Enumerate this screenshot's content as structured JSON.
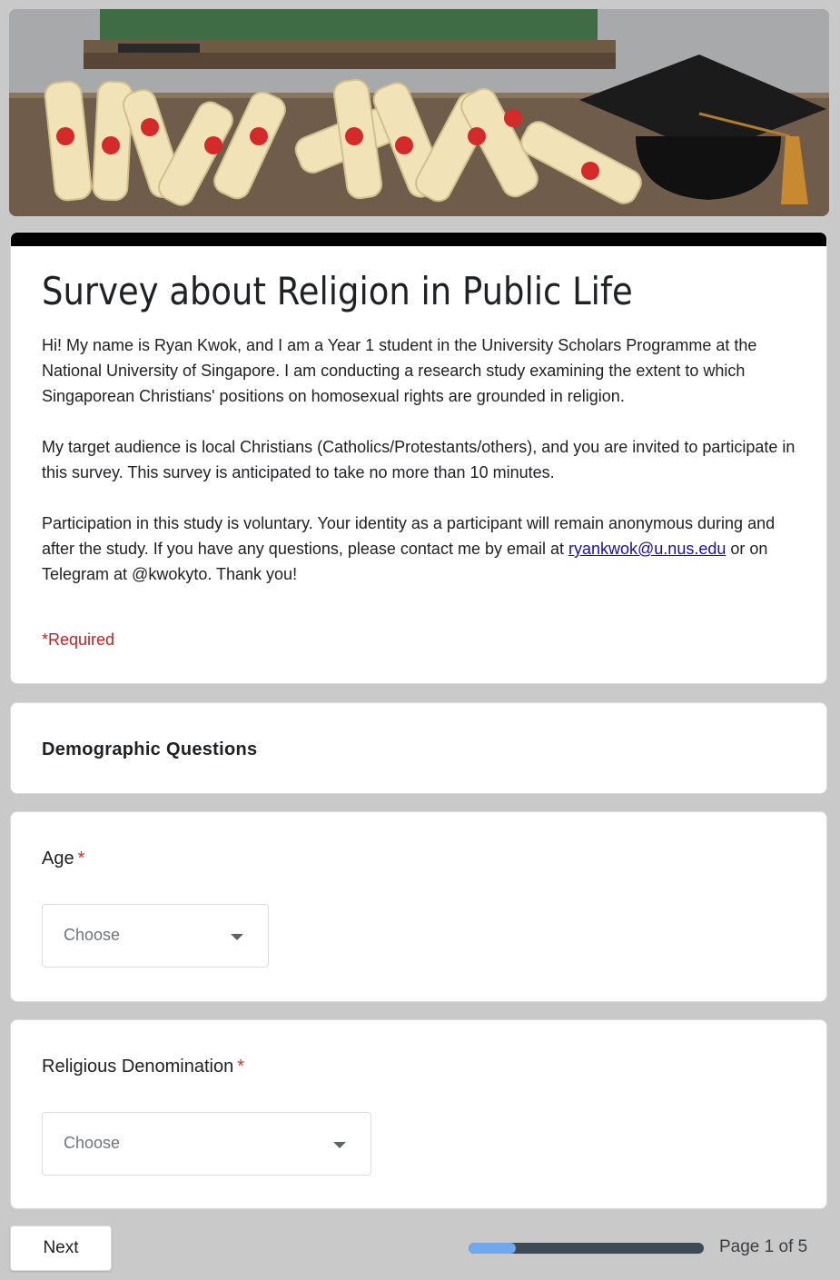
{
  "header": {
    "banner_image": "graduation-scrolls-and-cap-banner"
  },
  "form": {
    "accent_color": "#000000",
    "title": "Survey about Religion in Public Life",
    "description": {
      "para1": "Hi! My name is Ryan Kwok, and I am a Year 1 student in the University Scholars Programme at the National University of Singapore. I am conducting a research study examining the extent to which Singaporean Christians' positions on homosexual rights are grounded in religion.",
      "para2": "My target audience is local Christians (Catholics/Protestants/others), and you are invited to participate in this survey. This survey is anticipated to take no more than 10 minutes.",
      "para3_before": "Participation in this study is voluntary. Your identity as a participant will remain anonymous during and after the study. If you have any questions, please contact me by email at ",
      "email_link": "ryankwok@u.nus.edu",
      "para3_after": " or on Telegram at @kwokyto. Thank you!"
    },
    "required_note": "*Required"
  },
  "section": {
    "title": "Demographic Questions"
  },
  "questions": [
    {
      "label": "Age",
      "required_mark": "*",
      "placeholder": "Choose",
      "icon": "chevron-down-icon"
    },
    {
      "label": "Religious Denomination",
      "required_mark": "*",
      "placeholder": "Choose",
      "icon": "chevron-down-icon"
    }
  ],
  "footer": {
    "next_label": "Next",
    "progress": 0.2,
    "page_label": "Page 1 of 5",
    "progress_color": "#6fa8ef",
    "track_color": "#3c4a55"
  }
}
